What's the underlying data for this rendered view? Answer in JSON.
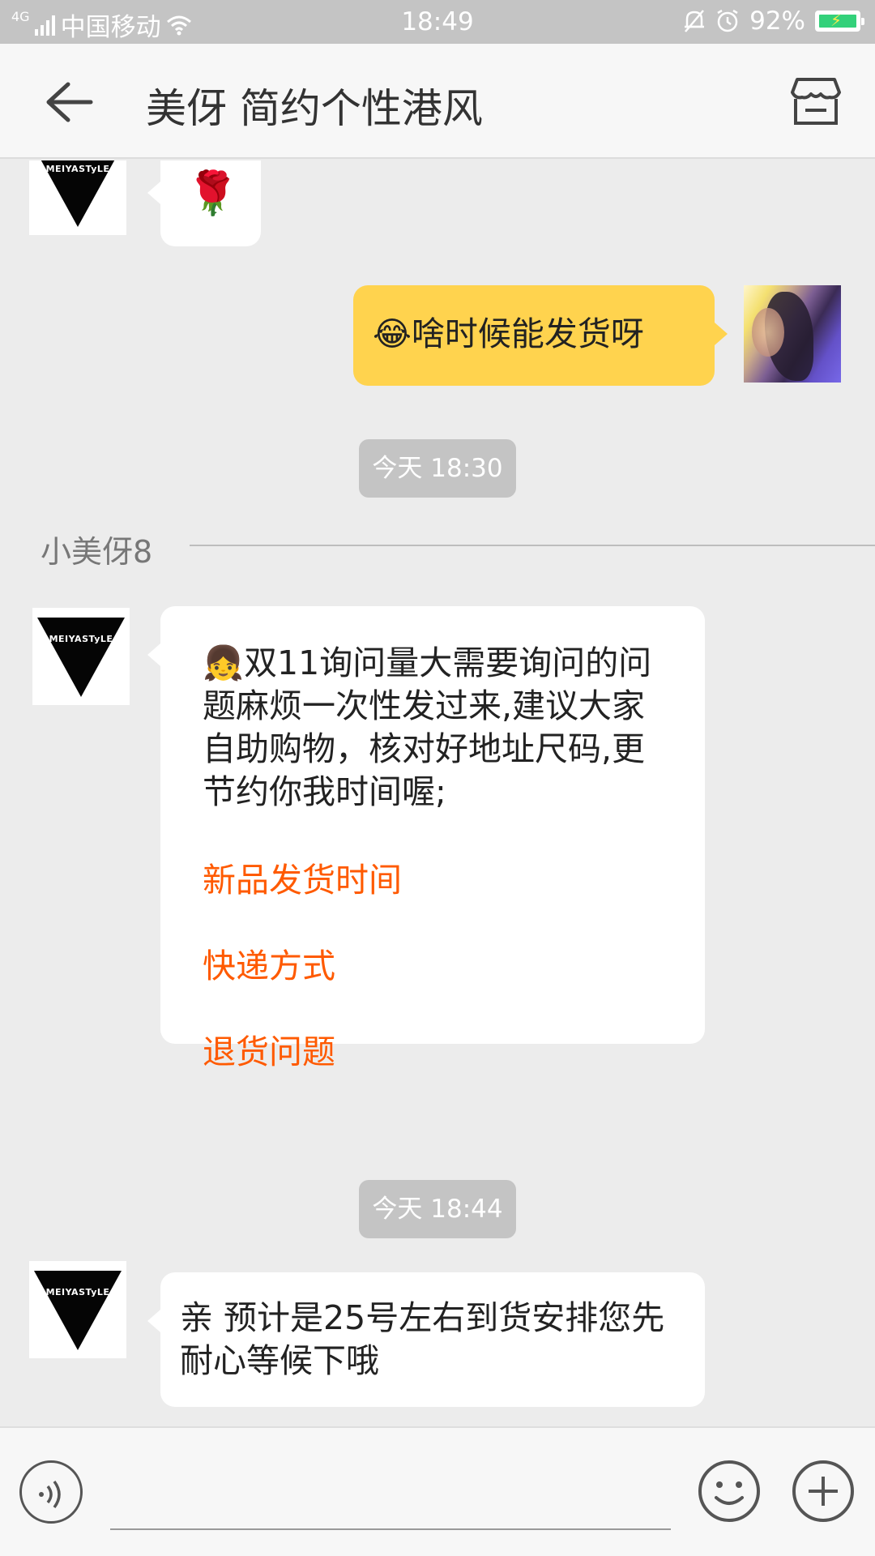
{
  "status_bar": {
    "network": "4G",
    "carrier": "中国移动",
    "time": "18:49",
    "battery": "92%"
  },
  "header": {
    "title": "美伢 简约个性港风",
    "icons": [
      "back-arrow-icon",
      "store-icon"
    ]
  },
  "messages": {
    "brand_logo_text": "MEIYASTyLE",
    "rose": "🌹",
    "user_msg": "😂啥时候能发货呀",
    "time1": "今天 18:30",
    "agent_name": "小美伢8",
    "auto_reply": {
      "emoji": "👧",
      "text": "双11询问量大需要询问的问题麻烦一次性发过来,建议大家自助购物，核对好地址尺码,更节约你我时间喔;",
      "options": [
        "新品发货时间",
        "快递方式",
        "退货问题"
      ]
    },
    "time2": "今天 18:44",
    "reply": "亲 预计是25号左右到货安排您先耐心等候下哦"
  },
  "input_bar": {
    "placeholder": "",
    "icons": [
      "voice-icon",
      "emoji-icon",
      "plus-icon"
    ]
  },
  "colors": {
    "accent_bubble": "#ffd34e",
    "link": "#ff5a00",
    "background": "#ececec"
  }
}
